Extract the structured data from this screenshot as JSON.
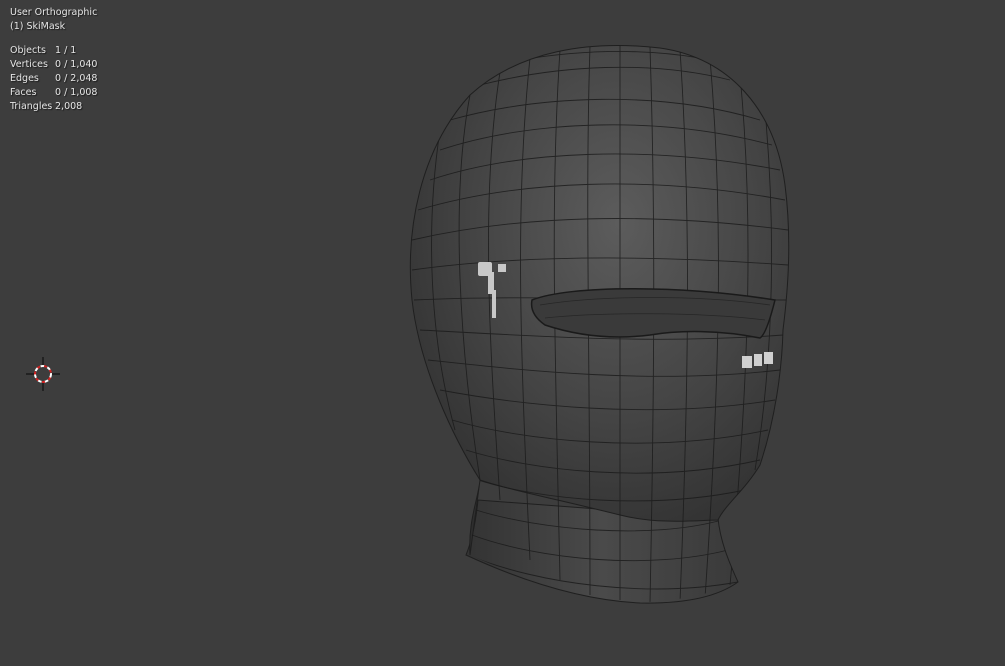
{
  "viewport": {
    "view_name": "User Orthographic",
    "object_name": "(1) SkiMask",
    "background_color": "#3d3d3d"
  },
  "stats": [
    {
      "label": "Objects",
      "value": "1 / 1"
    },
    {
      "label": "Vertices",
      "value": "0 / 1,040"
    },
    {
      "label": "Edges",
      "value": "0 / 2,048"
    },
    {
      "label": "Faces",
      "value": "0 / 1,008"
    },
    {
      "label": "Triangles",
      "value": "2,008"
    }
  ],
  "icons": {
    "cursor": "3d-cursor-icon"
  }
}
